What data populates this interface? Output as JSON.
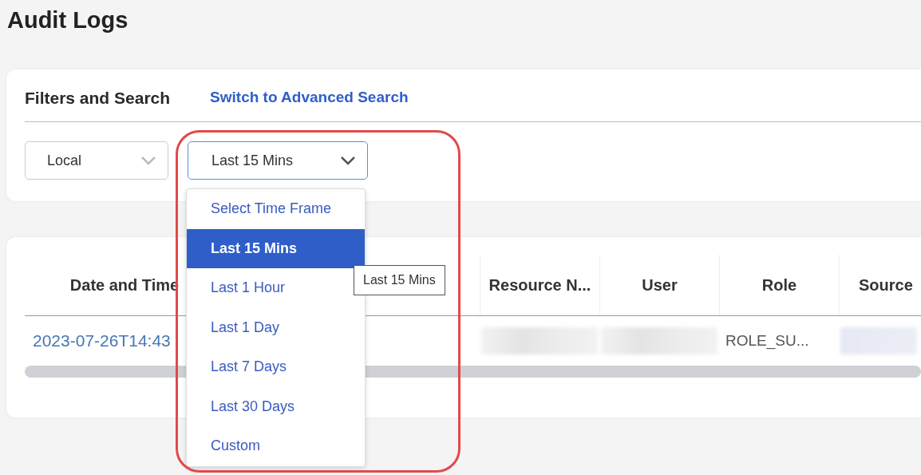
{
  "page": {
    "title": "Audit Logs"
  },
  "filters": {
    "title": "Filters and Search",
    "advanced_link": "Switch to Advanced Search",
    "scope_select": {
      "value": "Local"
    },
    "time_select": {
      "value": "Last 15 Mins",
      "expanded": true
    },
    "time_options": [
      {
        "label": "Select Time Frame",
        "selected": false
      },
      {
        "label": "Last 15 Mins",
        "selected": true
      },
      {
        "label": "Last 1 Hour",
        "selected": false
      },
      {
        "label": "Last 1 Day",
        "selected": false
      },
      {
        "label": "Last 7 Days",
        "selected": false
      },
      {
        "label": "Last 30 Days",
        "selected": false
      },
      {
        "label": "Custom",
        "selected": false
      }
    ],
    "tooltip": "Last 15 Mins"
  },
  "table": {
    "columns": [
      {
        "label": "Date and Time"
      },
      {},
      {},
      {
        "label": "Resource N..."
      },
      {
        "label": "User"
      },
      {
        "label": "Role"
      },
      {
        "label": "Source"
      }
    ],
    "rows": [
      {
        "cells": [
          {
            "kind": "link",
            "text": "2023-07-26T14:43"
          },
          {
            "kind": "empty"
          },
          {
            "kind": "empty"
          },
          {
            "kind": "redacted"
          },
          {
            "kind": "redacted"
          },
          {
            "kind": "text",
            "text": "ROLE_SU..."
          },
          {
            "kind": "redacted-blue"
          }
        ]
      }
    ]
  }
}
